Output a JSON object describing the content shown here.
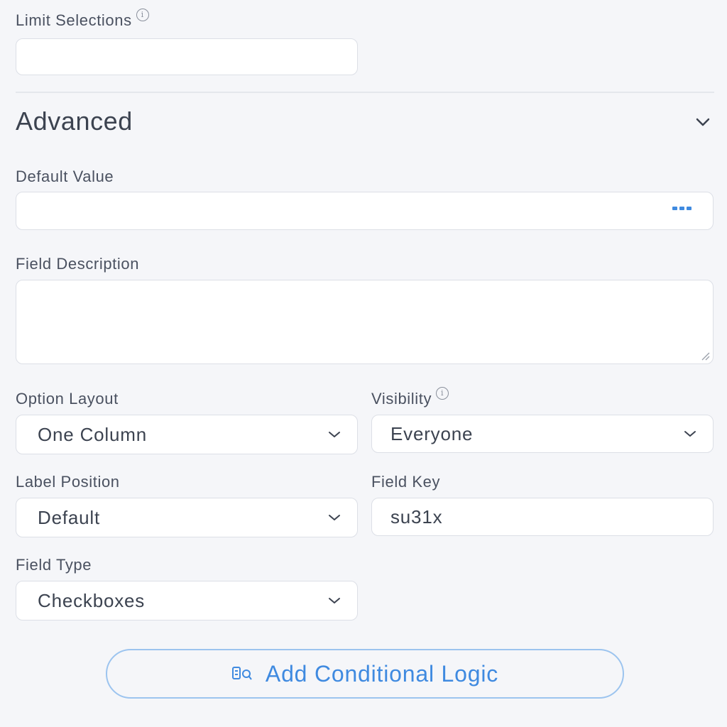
{
  "limit_selections": {
    "label": "Limit Selections",
    "value": ""
  },
  "advanced": {
    "title": "Advanced"
  },
  "default_value": {
    "label": "Default Value",
    "value": ""
  },
  "field_description": {
    "label": "Field Description",
    "value": ""
  },
  "option_layout": {
    "label": "Option Layout",
    "selected": "One Column"
  },
  "visibility": {
    "label": "Visibility",
    "selected": "Everyone"
  },
  "label_position": {
    "label": "Label Position",
    "selected": "Default"
  },
  "field_key": {
    "label": "Field Key",
    "value": "su31x"
  },
  "field_type": {
    "label": "Field Type",
    "selected": "Checkboxes"
  },
  "conditional_logic": {
    "label": "Add Conditional Logic"
  },
  "colors": {
    "accent": "#3f8ae0",
    "background": "#f5f6f9",
    "border": "#dcdfe6"
  }
}
